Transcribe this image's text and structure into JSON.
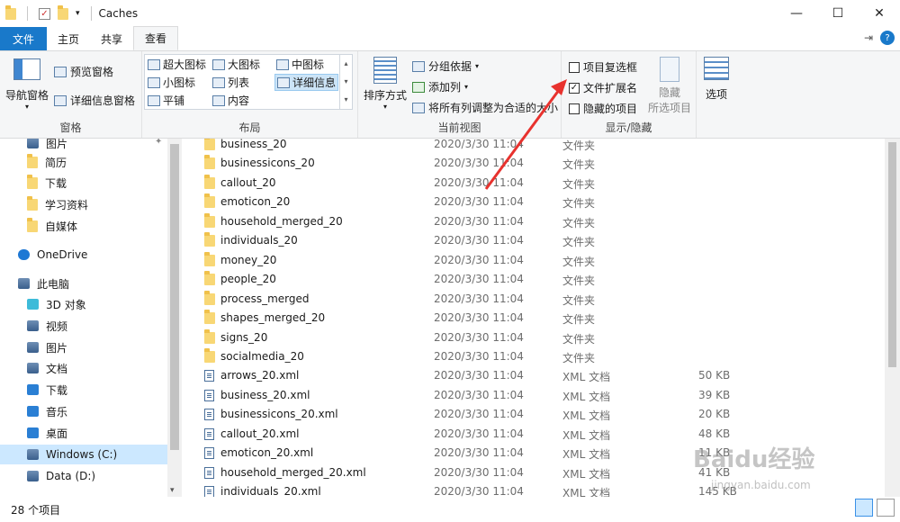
{
  "window": {
    "title": "Caches"
  },
  "tabs": {
    "file": "文件",
    "home": "主页",
    "share": "共享",
    "view": "查看"
  },
  "ribbon": {
    "panes": {
      "nav_pane": "导航窗格",
      "preview_pane": "预览窗格",
      "details_pane": "详细信息窗格",
      "label": "窗格"
    },
    "layout": {
      "items": [
        "超大图标",
        "大图标",
        "中图标",
        "小图标",
        "列表",
        "详细信息",
        "平铺",
        "内容"
      ],
      "selected": "详细信息",
      "label": "布局"
    },
    "current_view": {
      "sort": "排序方式",
      "group_by": "分组依据",
      "add_column": "添加列",
      "fit_columns": "将所有列调整为合适的大小",
      "label": "当前视图"
    },
    "show_hide": {
      "item_checkboxes": "项目复选框",
      "item_checkboxes_checked": false,
      "file_extensions": "文件扩展名",
      "file_extensions_checked": true,
      "hidden_items": "隐藏的项目",
      "hidden_items_checked": false,
      "hide_selected_1": "隐藏",
      "hide_selected_2": "所选项目",
      "label": "显示/隐藏"
    },
    "options": "选项"
  },
  "nav": [
    {
      "label": "图片",
      "icon": "pictures-icon"
    },
    {
      "label": "简历",
      "icon": "folder-icon"
    },
    {
      "label": "下载",
      "icon": "folder-icon"
    },
    {
      "label": "学习资料",
      "icon": "folder-icon"
    },
    {
      "label": "自媒体",
      "icon": "folder-icon"
    },
    {
      "label": "OneDrive",
      "icon": "onedrive-icon"
    },
    {
      "label": "此电脑",
      "icon": "this-pc-icon"
    },
    {
      "label": "3D 对象",
      "icon": "3d-objects-icon"
    },
    {
      "label": "视频",
      "icon": "videos-icon"
    },
    {
      "label": "图片",
      "icon": "pictures-icon"
    },
    {
      "label": "文档",
      "icon": "documents-icon"
    },
    {
      "label": "下载",
      "icon": "downloads-icon"
    },
    {
      "label": "音乐",
      "icon": "music-icon"
    },
    {
      "label": "桌面",
      "icon": "desktop-icon"
    },
    {
      "label": "Windows (C:)",
      "icon": "drive-c-icon"
    },
    {
      "label": "Data (D:)",
      "icon": "drive-d-icon"
    }
  ],
  "files": [
    {
      "name": "business_20",
      "date": "2020/3/30 11:04",
      "type": "文件夹",
      "size": "",
      "icon": "folder"
    },
    {
      "name": "businessicons_20",
      "date": "2020/3/30 11:04",
      "type": "文件夹",
      "size": "",
      "icon": "folder"
    },
    {
      "name": "callout_20",
      "date": "2020/3/30 11:04",
      "type": "文件夹",
      "size": "",
      "icon": "folder"
    },
    {
      "name": "emoticon_20",
      "date": "2020/3/30 11:04",
      "type": "文件夹",
      "size": "",
      "icon": "folder"
    },
    {
      "name": "household_merged_20",
      "date": "2020/3/30 11:04",
      "type": "文件夹",
      "size": "",
      "icon": "folder"
    },
    {
      "name": "individuals_20",
      "date": "2020/3/30 11:04",
      "type": "文件夹",
      "size": "",
      "icon": "folder"
    },
    {
      "name": "money_20",
      "date": "2020/3/30 11:04",
      "type": "文件夹",
      "size": "",
      "icon": "folder"
    },
    {
      "name": "people_20",
      "date": "2020/3/30 11:04",
      "type": "文件夹",
      "size": "",
      "icon": "folder"
    },
    {
      "name": "process_merged",
      "date": "2020/3/30 11:04",
      "type": "文件夹",
      "size": "",
      "icon": "folder"
    },
    {
      "name": "shapes_merged_20",
      "date": "2020/3/30 11:04",
      "type": "文件夹",
      "size": "",
      "icon": "folder"
    },
    {
      "name": "signs_20",
      "date": "2020/3/30 11:04",
      "type": "文件夹",
      "size": "",
      "icon": "folder"
    },
    {
      "name": "socialmedia_20",
      "date": "2020/3/30 11:04",
      "type": "文件夹",
      "size": "",
      "icon": "folder"
    },
    {
      "name": "arrows_20.xml",
      "date": "2020/3/30 11:04",
      "type": "XML 文档",
      "size": "50 KB",
      "icon": "xml"
    },
    {
      "name": "business_20.xml",
      "date": "2020/3/30 11:04",
      "type": "XML 文档",
      "size": "39 KB",
      "icon": "xml"
    },
    {
      "name": "businessicons_20.xml",
      "date": "2020/3/30 11:04",
      "type": "XML 文档",
      "size": "20 KB",
      "icon": "xml"
    },
    {
      "name": "callout_20.xml",
      "date": "2020/3/30 11:04",
      "type": "XML 文档",
      "size": "48 KB",
      "icon": "xml"
    },
    {
      "name": "emoticon_20.xml",
      "date": "2020/3/30 11:04",
      "type": "XML 文档",
      "size": "11 KB",
      "icon": "xml"
    },
    {
      "name": "household_merged_20.xml",
      "date": "2020/3/30 11:04",
      "type": "XML 文档",
      "size": "41 KB",
      "icon": "xml"
    },
    {
      "name": "individuals_20.xml",
      "date": "2020/3/30 11:04",
      "type": "XML 文档",
      "size": "145 KB",
      "icon": "xml"
    }
  ],
  "status": {
    "count": "28 个项目"
  },
  "watermark": {
    "main": "Baidu经验",
    "sub": "jingyan.baidu.com"
  },
  "colors": {
    "accent": "#1979ca",
    "selected": "#cce8ff",
    "folder": "#f8d775",
    "arrow": "#e8322e"
  }
}
